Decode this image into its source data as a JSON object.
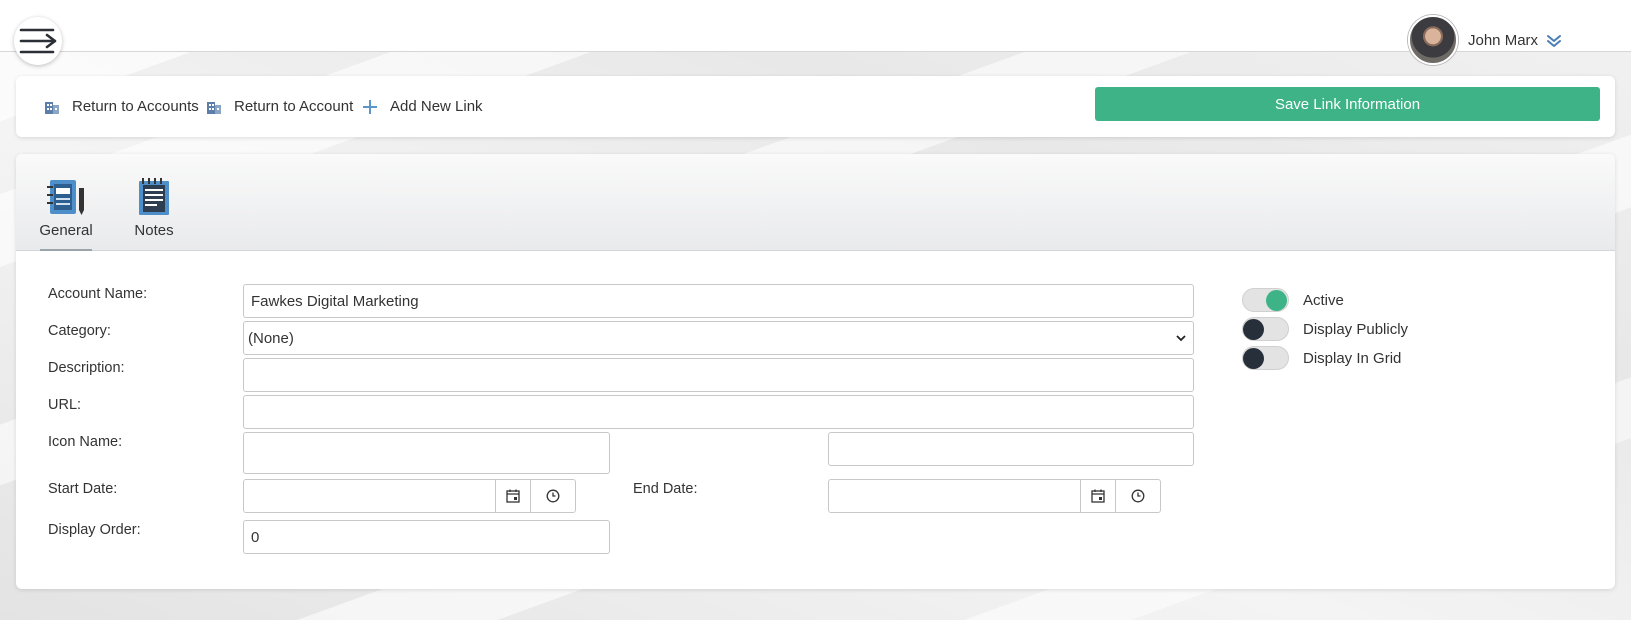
{
  "header": {
    "user_name": "John Marx",
    "icons": {
      "menu": "menu-arrow-icon",
      "caret": "double-chevron-down-icon"
    }
  },
  "toolbar": {
    "return_accounts_label": "Return to Accounts",
    "return_account_label": "Return to Account",
    "add_link_label": "Add New Link",
    "save_label": "Save Link Information",
    "save_color": "#3db387",
    "icons": {
      "building": "building-icon",
      "plus": "plus-icon"
    }
  },
  "tabs": [
    {
      "label": "General",
      "icon": "notebook-pen-icon",
      "active": true
    },
    {
      "label": "Notes",
      "icon": "notepad-icon",
      "active": false
    }
  ],
  "form": {
    "account_name_label": "Account Name:",
    "account_name_value": "Fawkes Digital Marketing",
    "category_label": "Category:",
    "category_value": "(None)",
    "description_label": "Description:",
    "description_value": "",
    "url_label": "URL:",
    "url_value": "",
    "icon_name_label": "Icon Name:",
    "icon_name_value": "",
    "icon_extra_value": "",
    "start_date_label": "Start Date:",
    "start_date_value": "",
    "end_date_label": "End Date:",
    "end_date_value": "",
    "display_order_label": "Display Order:",
    "display_order_value": "0"
  },
  "switches": [
    {
      "label": "Active",
      "on": true
    },
    {
      "label": "Display Publicly",
      "on": false
    },
    {
      "label": "Display In Grid",
      "on": false
    }
  ],
  "colors": {
    "switch_on": "#3db387",
    "switch_off": "#27303a"
  }
}
